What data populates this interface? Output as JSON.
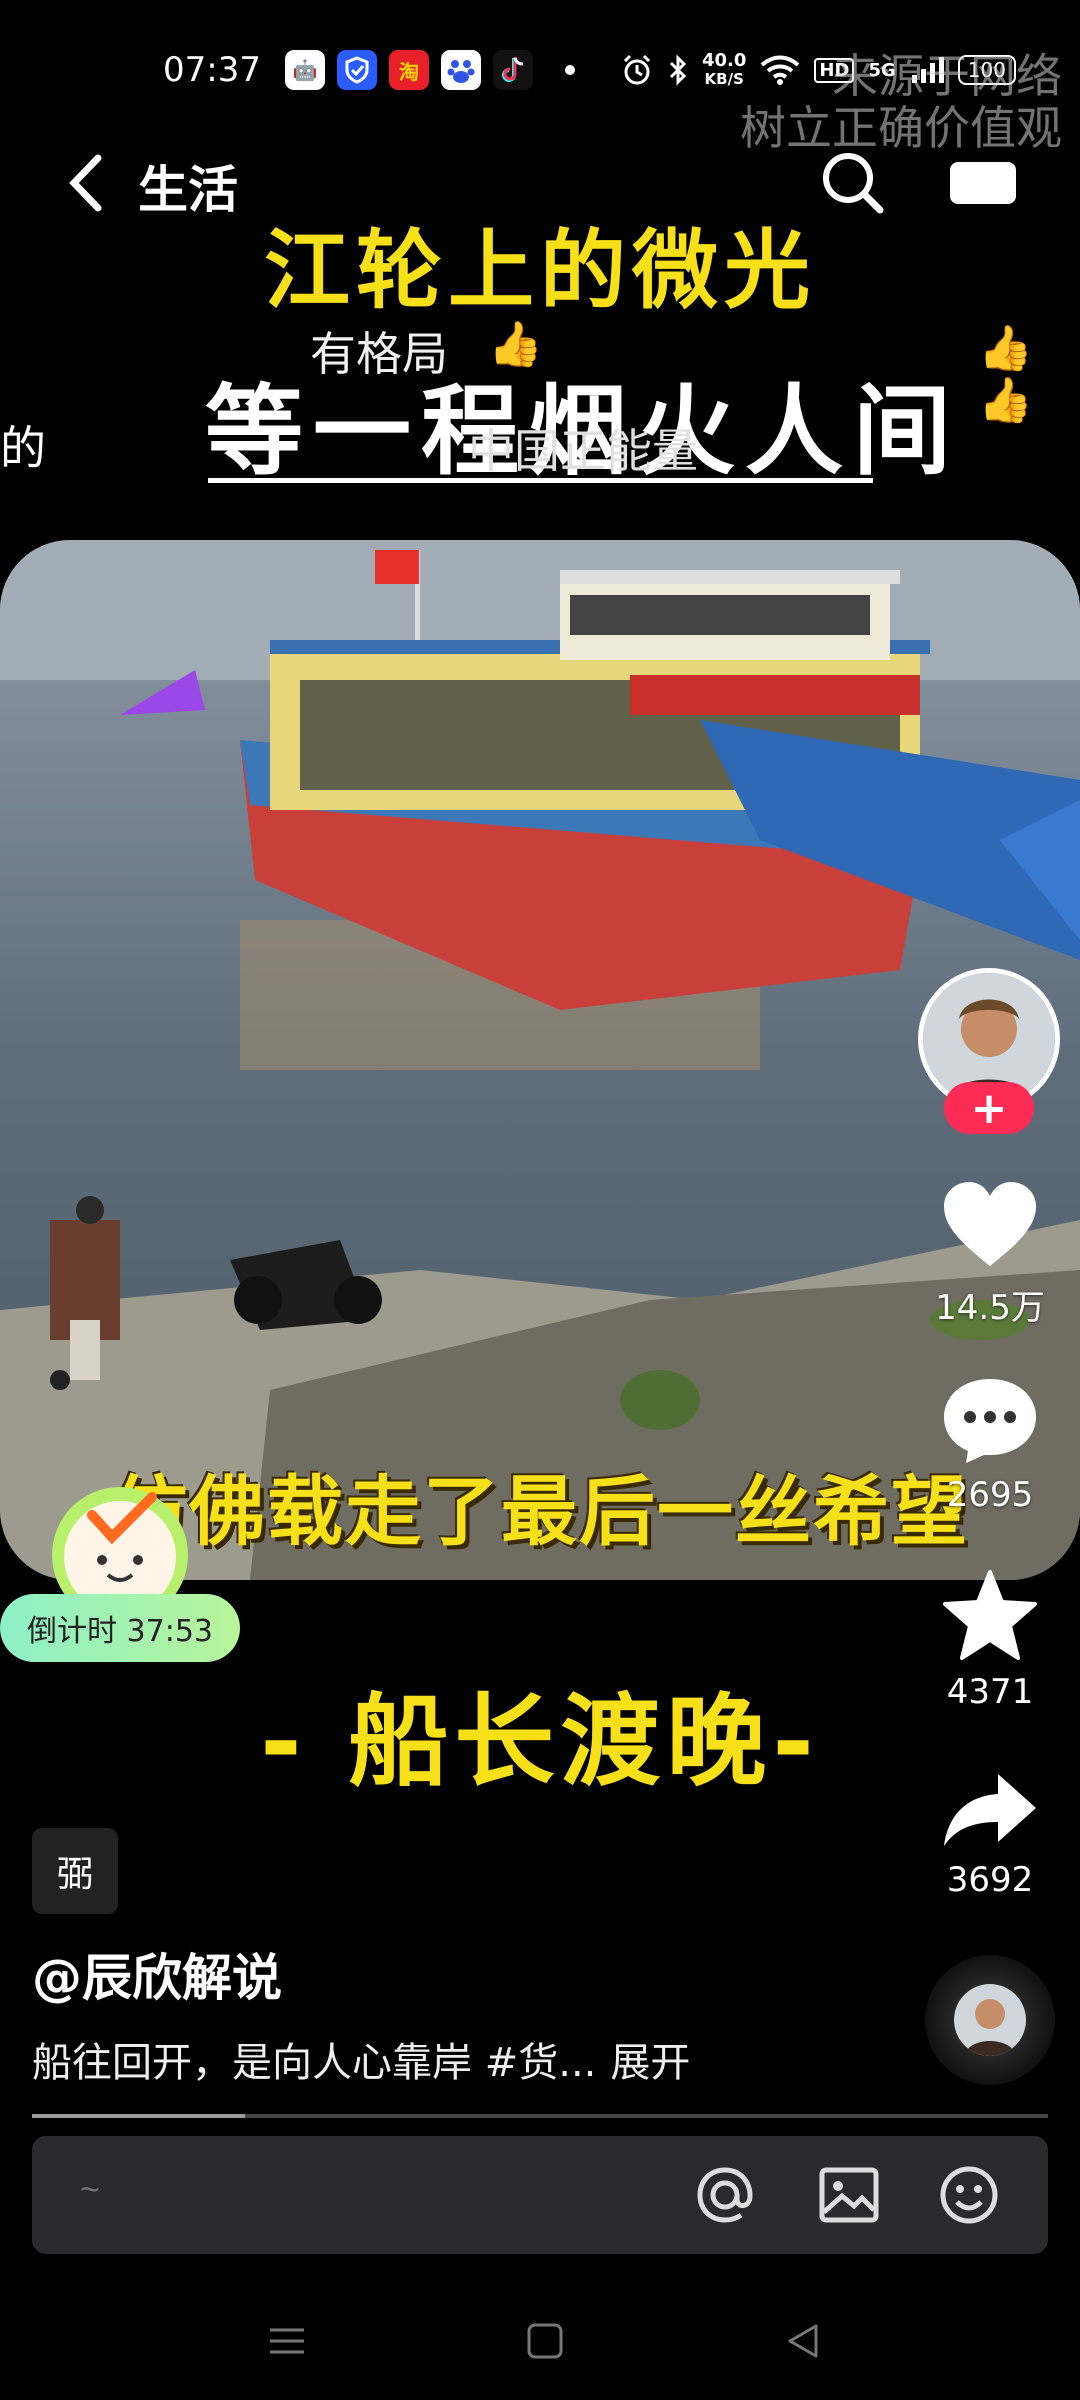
{
  "status_bar": {
    "time": "07:37",
    "speed_value": "40.0",
    "speed_unit": "KB/S",
    "hd": "HD",
    "network": "5G",
    "battery": "100"
  },
  "watermark": {
    "line1": "来源于网络",
    "line2": "树立正确价值观"
  },
  "nav": {
    "title": "生活"
  },
  "video_text": {
    "headline": "江轮上的微光",
    "subheadline": "等一程烟火人间",
    "side_text": "的",
    "overlay_a": "有格局",
    "overlay_b": "中国正能量",
    "thumbs_a": "👍",
    "thumbs_b": "👍👍",
    "caption": "仿佛载走了最后一丝希望",
    "title_bar": "- 船长渡晚-"
  },
  "timer": {
    "label": "倒计时 37:53"
  },
  "actions": {
    "follow": "+",
    "likes": "14.5万",
    "comments": "2695",
    "favorites": "4371",
    "shares": "3692"
  },
  "post": {
    "tag_icon": "弼",
    "author": "@辰欣解说",
    "description": "船往回开，是向人心靠岸 #货...",
    "expand": "展开",
    "progress": 0.21
  },
  "comment": {
    "placeholder": "~"
  },
  "colors": {
    "headline": "#f7e017",
    "follow": "#fe2c55",
    "timer_start": "#8df0c8",
    "timer_end": "#b8f59a"
  },
  "icons": [
    "back-icon",
    "search-icon",
    "more-icon",
    "heart-icon",
    "comment-icon",
    "star-icon",
    "share-icon",
    "at-icon",
    "image-icon",
    "emoji-icon",
    "menu-nav-icon",
    "home-nav-icon",
    "back-nav-icon"
  ]
}
